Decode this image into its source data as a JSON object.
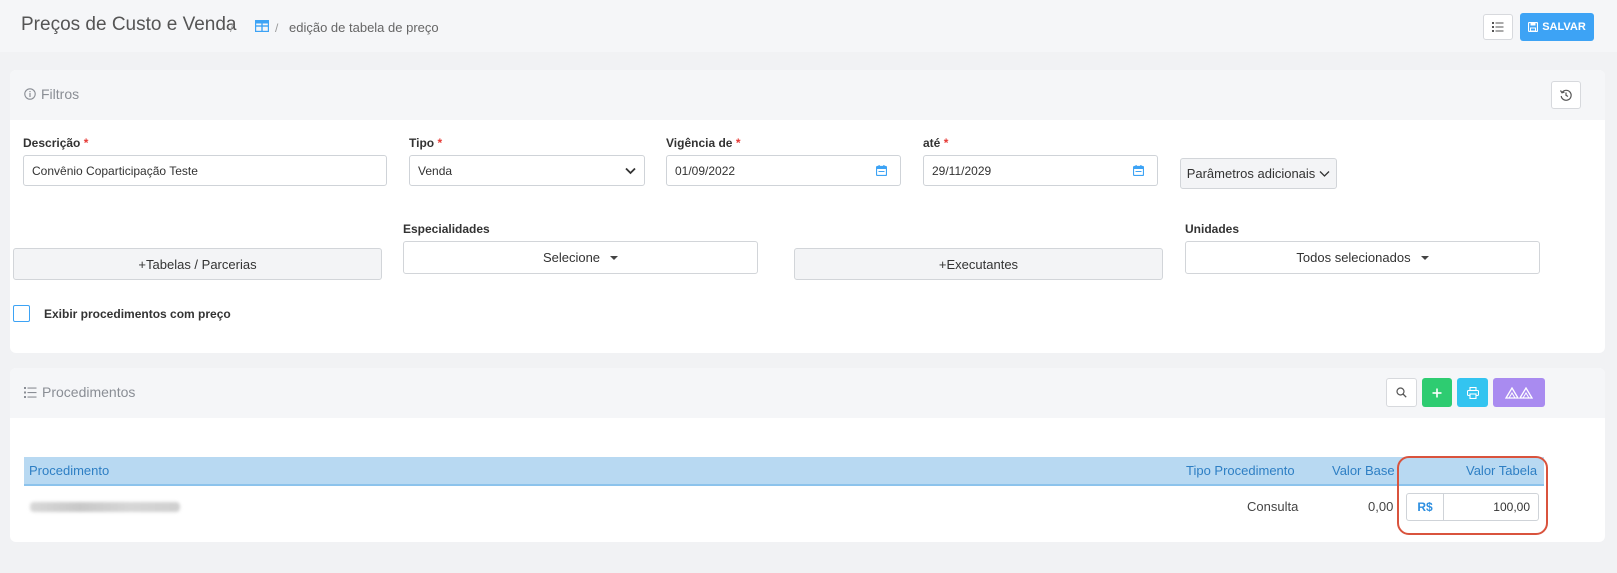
{
  "header": {
    "title": "Preços de Custo e Venda",
    "separator": "/",
    "breadcrumb_current": "edição de tabela de preço",
    "save_label": "SALVAR"
  },
  "filtros": {
    "title": "Filtros",
    "descricao": {
      "label": "Descrição",
      "required": "*",
      "value": "Convênio Coparticipação Teste"
    },
    "tipo": {
      "label": "Tipo",
      "required": "*",
      "value": "Venda"
    },
    "vigencia_de": {
      "label": "Vigência de",
      "required": "*",
      "value": "01/09/2022"
    },
    "ate": {
      "label": "até",
      "required": "*",
      "value": "29/11/2029"
    },
    "parametros_label": "Parâmetros adicionais",
    "especialidades": {
      "label": "Especialidades",
      "value": "Selecione"
    },
    "unidades": {
      "label": "Unidades",
      "value": "Todos selecionados"
    },
    "tabelas_button": "Tabelas / Parcerias",
    "executantes_button": "Executantes",
    "exibir_label": "Exibir procedimentos com preço",
    "plus": "+"
  },
  "procedimentos": {
    "title": "Procedimentos",
    "columns": {
      "procedimento": "Procedimento",
      "tipo": "Tipo Procedimento",
      "valor_base": "Valor Base",
      "valor_tabela": "Valor Tabela"
    },
    "rows": [
      {
        "tipo": "Consulta",
        "valor_base": "0,00",
        "currency": "R$",
        "valor_tabela": "100,00"
      }
    ]
  },
  "colors": {
    "accent": "#3da3f5",
    "green": "#2ecc71",
    "cyan": "#33c4f0",
    "purple": "#a98bf0",
    "highlight": "#d9533d"
  }
}
